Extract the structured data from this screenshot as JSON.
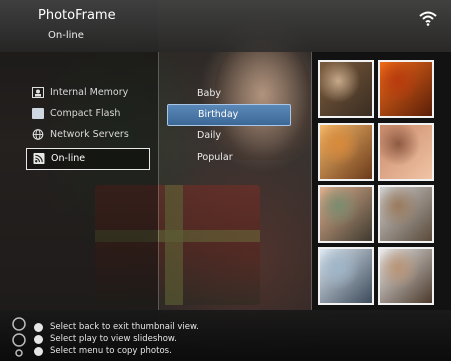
{
  "header": {
    "title": "PhotoFrame",
    "subtitle": "On-line"
  },
  "menu": [
    {
      "label": "Internal Memory",
      "icon": "frame-icon"
    },
    {
      "label": "Compact Flash",
      "icon": "card-icon"
    },
    {
      "label": "Network Servers",
      "icon": "globe-icon"
    },
    {
      "label": "On-line",
      "icon": "rss-icon",
      "selected": true
    }
  ],
  "sub_menu": [
    {
      "label": "Baby"
    },
    {
      "label": "Birthday",
      "highlighted": true
    },
    {
      "label": "Daily"
    },
    {
      "label": "Popular"
    }
  ],
  "thumbnails": [
    {
      "name": "thumb-1",
      "colors": [
        "#7a5b3c",
        "#c7a98a",
        "#3a2d22"
      ]
    },
    {
      "name": "thumb-2",
      "colors": [
        "#f06a19",
        "#b83a0e",
        "#5a1e08"
      ]
    },
    {
      "name": "thumb-3",
      "colors": [
        "#f5b86a",
        "#d98a3a",
        "#6a3a1a"
      ]
    },
    {
      "name": "thumb-4",
      "colors": [
        "#c9896a",
        "#8d5a42",
        "#f0c4a5"
      ]
    },
    {
      "name": "thumb-5",
      "colors": [
        "#e0b08f",
        "#7a8c6f",
        "#3e3a2f"
      ]
    },
    {
      "name": "thumb-6",
      "colors": [
        "#cfcfcf",
        "#9a7a5c",
        "#5a4a3a"
      ]
    },
    {
      "name": "thumb-7",
      "colors": [
        "#dfe9f2",
        "#9fb6c9",
        "#3c4a5a"
      ]
    },
    {
      "name": "thumb-8",
      "colors": [
        "#eaeaea",
        "#b99475",
        "#4c3a2c"
      ]
    }
  ],
  "footer": {
    "hints": [
      {
        "label": "Select back to exit thumbnail view."
      },
      {
        "label": "Select play to view slideshow."
      },
      {
        "label": "Select menu to copy photos."
      }
    ]
  },
  "colors": {
    "highlight": "#4f7eb0",
    "text": "#ececec"
  }
}
